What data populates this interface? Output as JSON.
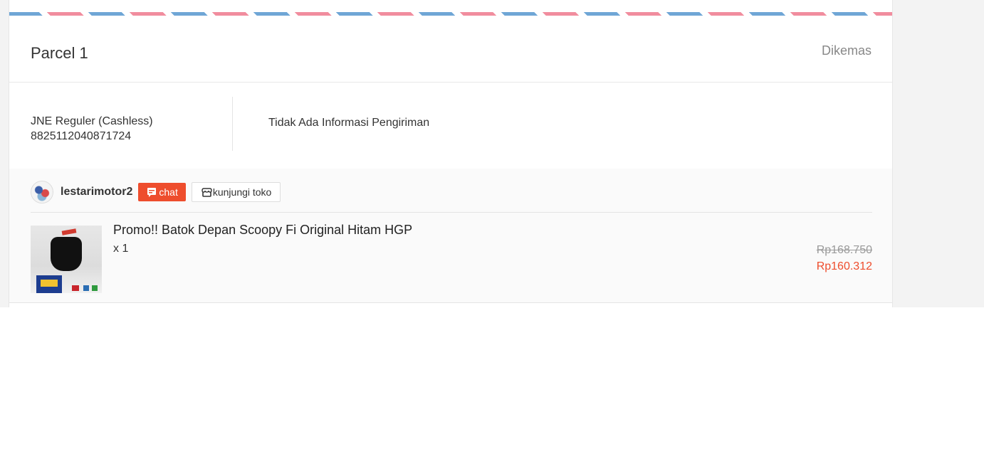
{
  "parcel": {
    "title": "Parcel 1",
    "status": "Dikemas"
  },
  "shipping": {
    "courier": "JNE Reguler (Cashless)",
    "tracking_number": "8825112040871724",
    "info": "Tidak Ada Informasi Pengiriman"
  },
  "shop": {
    "name": "lestarimotor2",
    "chat_label": "chat",
    "visit_label": "kunjungi toko"
  },
  "product": {
    "name": "Promo!! Batok Depan Scoopy Fi Original Hitam HGP",
    "quantity": "x 1",
    "price_original": "Rp168.750",
    "price_discounted": "Rp160.312"
  },
  "colors": {
    "accent": "#ee4d2d",
    "airmail_blue": "#6fa6d6",
    "airmail_pink": "#f18d9e"
  },
  "icons": {
    "chat": "chat-bubble-icon",
    "shop": "shop-icon"
  }
}
